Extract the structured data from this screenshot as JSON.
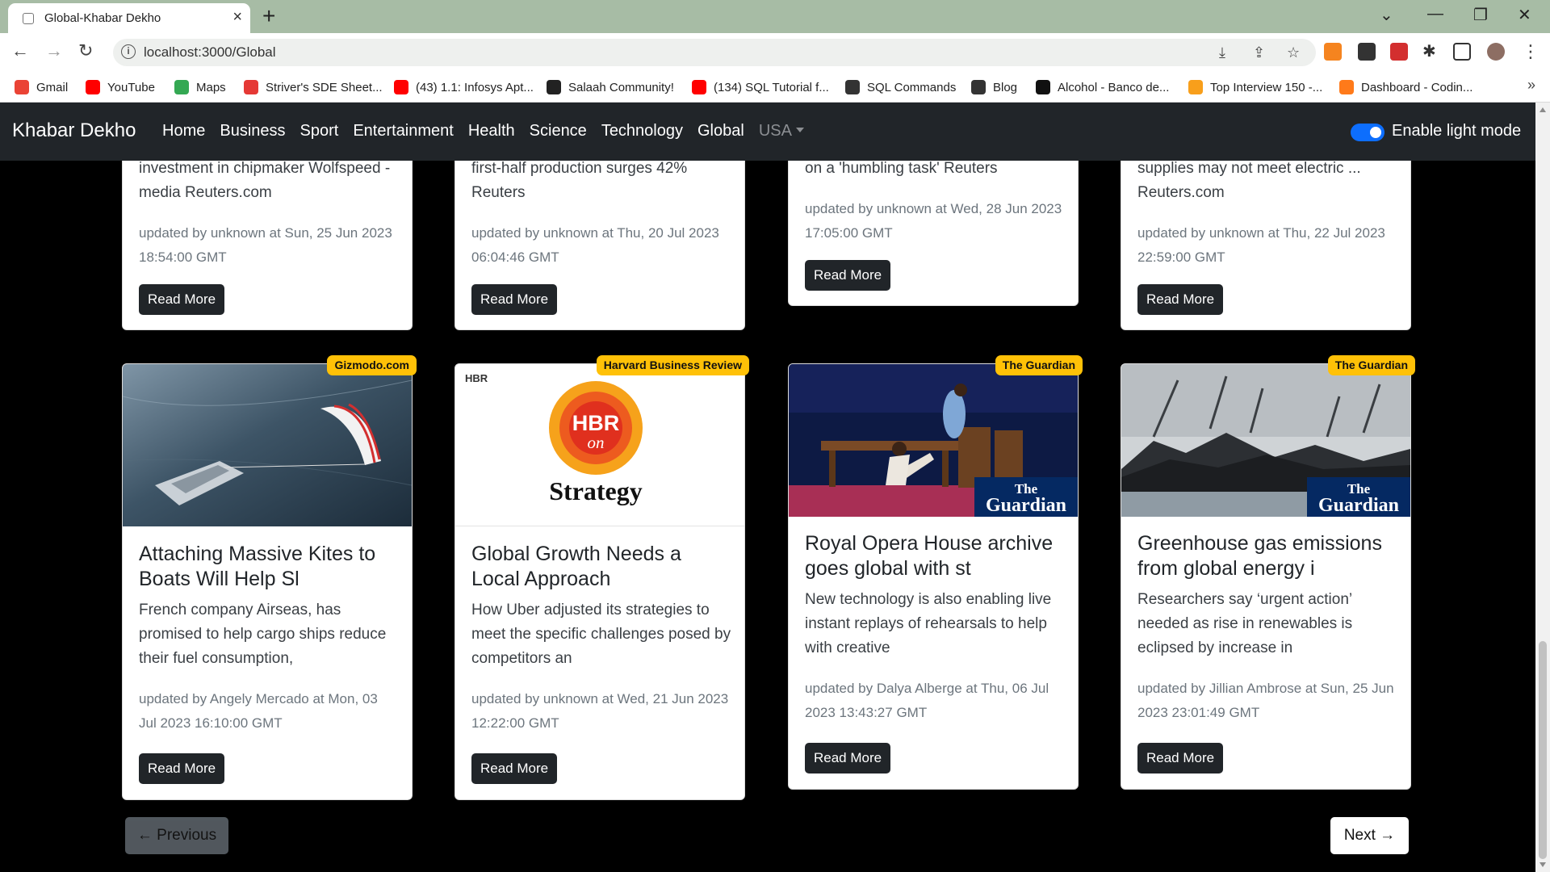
{
  "browser": {
    "tab_title": "Global-Khabar Dekho",
    "url": "localhost:3000/Global",
    "bookmarks": [
      {
        "label": "Gmail",
        "color": "#ea4335"
      },
      {
        "label": "YouTube",
        "color": "#ff0000"
      },
      {
        "label": "Maps",
        "color": "#34a853"
      },
      {
        "label": "Striver's SDE Sheet...",
        "color": "#e53935"
      },
      {
        "label": "(43) 1.1: Infosys Apt...",
        "color": "#ff0000"
      },
      {
        "label": "Salaah Community!",
        "color": "#222222"
      },
      {
        "label": "(134) SQL Tutorial f...",
        "color": "#ff0000"
      },
      {
        "label": "SQL Commands",
        "color": "#333333"
      },
      {
        "label": "Blog",
        "color": "#333333"
      },
      {
        "label": "Alcohol - Banco de...",
        "color": "#111111"
      },
      {
        "label": "Top Interview 150 -...",
        "color": "#f89f1b"
      },
      {
        "label": "Dashboard - Codin...",
        "color": "#ff7a1a"
      }
    ]
  },
  "site": {
    "brand": "Khabar Dekho",
    "nav": [
      "Home",
      "Business",
      "Sport",
      "Entertainment",
      "Health",
      "Science",
      "Technology",
      "Global"
    ],
    "country": "USA",
    "toggle_label": "Enable light mode"
  },
  "top_cards": [
    {
      "title_tail": "investment in chipmaker Wolfspeed - media  Reuters.com",
      "meta": "updated by unknown at Sun, 25 Jun 2023 18:54:00 GMT",
      "button": "Read More"
    },
    {
      "title_tail": "first-half production surges 42%  Reuters",
      "meta": "updated by unknown at Thu, 20 Jul 2023 06:04:46 GMT",
      "button": "Read More"
    },
    {
      "title_tail": "on a 'humbling task'  Reuters",
      "meta": "updated by unknown at Wed, 28 Jun 2023 17:05:00 GMT",
      "button": "Read More"
    },
    {
      "title_tail": "supplies may not meet electric ...  Reuters.com",
      "meta": "updated by unknown at Thu, 22 Jul 2023 22:59:00 GMT",
      "button": "Read More"
    }
  ],
  "cards": [
    {
      "source": "Gizmodo.com",
      "title": "Attaching Massive Kites to Boats Will Help Sl",
      "desc": "French company Airseas, has promised to help cargo ships reduce their fuel consumption,",
      "meta": "updated by Angely Mercado at Mon, 03 Jul 2023 16:10:00 GMT",
      "button": "Read More"
    },
    {
      "source": "Harvard Business Review",
      "title": "Global Growth Needs a Local Approach",
      "desc": "How Uber adjusted its strategies to meet the specific challenges posed by competitors an",
      "meta": "updated by unknown at Wed, 21 Jun 2023 12:22:00 GMT",
      "button": "Read More",
      "image_text": {
        "corner": "HBR",
        "logo_top": "HBR",
        "logo_bottom": "on",
        "word": "Strategy"
      }
    },
    {
      "source": "The Guardian",
      "title": "Royal Opera House archive goes global with st",
      "desc": "New technology is also enabling live instant replays of rehearsals to help with creative",
      "meta": "updated by Dalya Alberge at Thu, 06 Jul 2023 13:43:27 GMT",
      "button": "Read More",
      "image_text": {
        "logo_top": "The",
        "logo_bottom": "Guardian"
      }
    },
    {
      "source": "The Guardian",
      "title": "Greenhouse gas emissions from global energy i",
      "desc": "Researchers say ‘urgent action’ needed as rise in renewables is eclipsed by increase in",
      "meta": "updated by Jillian Ambrose at Sun, 25 Jun 2023 23:01:49 GMT",
      "button": "Read More",
      "image_text": {
        "logo_top": "The",
        "logo_bottom": "Guardian"
      }
    }
  ],
  "pagination": {
    "prev": "← Previous",
    "next": "Next →"
  },
  "colors": {
    "badge": "#ffc107",
    "navbar": "#212529",
    "toggle": "#0d6efd",
    "guardian_blue": "#052962"
  }
}
